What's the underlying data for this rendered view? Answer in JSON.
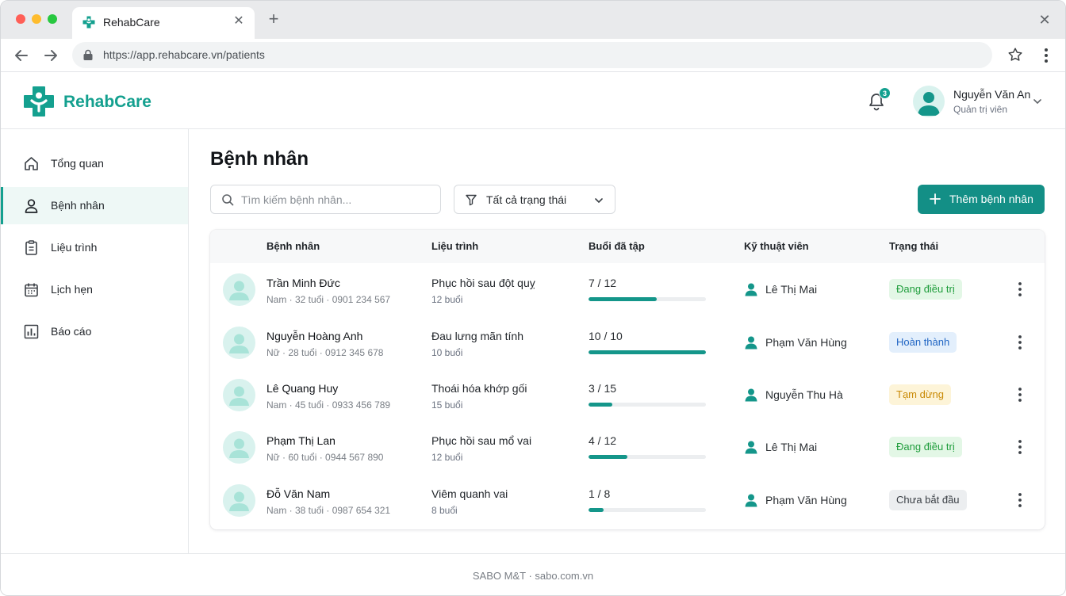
{
  "browser": {
    "tab_title": "RehabCare",
    "url": "https://app.rehabcare.vn/patients"
  },
  "app": {
    "brand": "RehabCare",
    "accent_color": "#14a08f",
    "notification_count": "3",
    "user": {
      "name": "Nguyễn Văn An",
      "role": "Quản trị viên"
    }
  },
  "sidebar": {
    "items": [
      {
        "label": "Tổng quan",
        "icon": "home-icon",
        "active": false
      },
      {
        "label": "Bệnh nhân",
        "icon": "user-icon",
        "active": true
      },
      {
        "label": "Liệu trình",
        "icon": "clipboard-icon",
        "active": false
      },
      {
        "label": "Lịch hẹn",
        "icon": "calendar-icon",
        "active": false
      },
      {
        "label": "Báo cáo",
        "icon": "bar-chart-icon",
        "active": false
      }
    ]
  },
  "main": {
    "title": "Bệnh nhân",
    "search_placeholder": "Tìm kiếm bệnh nhân...",
    "filter_label": "Tất cả trạng thái",
    "add_button_label": "Thêm bệnh nhân"
  },
  "table": {
    "headers": {
      "patient": "Bệnh nhân",
      "course": "Liệu trình",
      "sessions": "Buổi đã tập",
      "therapist": "Kỹ thuật viên",
      "status": "Trạng thái"
    },
    "rows": [
      {
        "name": "Trần Minh Đức",
        "meta": "Nam · 32 tuổi · 0901 234 567",
        "course": "Phục hồi sau đột quỵ",
        "course_sessions": "12 buổi",
        "sessions_text": "7 / 12",
        "progress": 0.583,
        "therapist": "Lê Thị Mai",
        "status": "Đang điều trị",
        "status_kind": "treat"
      },
      {
        "name": "Nguyễn Hoàng Anh",
        "meta": "Nữ · 28 tuổi · 0912 345 678",
        "course": "Đau lưng mãn tính",
        "course_sessions": "10 buổi",
        "sessions_text": "10 / 10",
        "progress": 1.0,
        "therapist": "Phạm Văn Hùng",
        "status": "Hoàn thành",
        "status_kind": "done"
      },
      {
        "name": "Lê Quang Huy",
        "meta": "Nam · 45 tuổi · 0933 456 789",
        "course": "Thoái hóa khớp gối",
        "course_sessions": "15 buổi",
        "sessions_text": "3 / 15",
        "progress": 0.2,
        "therapist": "Nguyễn Thu Hà",
        "status": "Tạm dừng",
        "status_kind": "pause"
      },
      {
        "name": "Phạm Thị Lan",
        "meta": "Nữ · 60 tuổi · 0944 567 890",
        "course": "Phục hồi sau mổ vai",
        "course_sessions": "12 buổi",
        "sessions_text": "4 / 12",
        "progress": 0.333,
        "therapist": "Lê Thị Mai",
        "status": "Đang điều trị",
        "status_kind": "treat"
      },
      {
        "name": "Đỗ Văn Nam",
        "meta": "Nam · 38 tuổi · 0987 654 321",
        "course": "Viêm quanh vai",
        "course_sessions": "8 buổi",
        "sessions_text": "1 / 8",
        "progress": 0.125,
        "therapist": "Phạm Văn Hùng",
        "status": "Chưa bắt đầu",
        "status_kind": "new"
      }
    ]
  },
  "footer": {
    "text": "SABO M&T · sabo.com.vn"
  }
}
